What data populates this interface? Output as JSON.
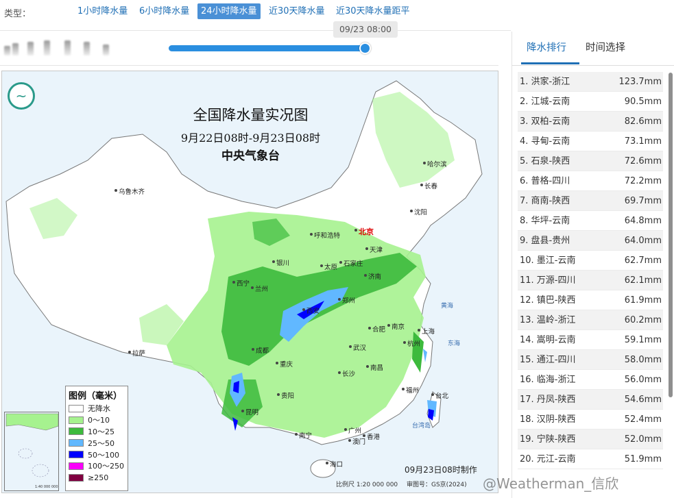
{
  "typebar": {
    "label": "类型：",
    "tabs": [
      {
        "label": "1小时降水量"
      },
      {
        "label": "6小时降水量"
      },
      {
        "label": "24小时降水量"
      },
      {
        "label": "近30天降水量"
      },
      {
        "label": "近30天降水量距平"
      }
    ],
    "active_tab": 2
  },
  "timeline": {
    "current_time": "09/23 08:00",
    "progress": 0.98
  },
  "map": {
    "title": "全国降水量实况图",
    "period": "9月22日08时-9月23日08时",
    "organization": "中央气象台",
    "made_time": "09月23日08时制作",
    "scale_note": "比例尺 1:20 000 000",
    "map_code": "审图号：GS京(2024)",
    "inset_caption": "1:40 000 000",
    "cities": [
      {
        "name": "乌鲁木齐"
      },
      {
        "name": "哈尔滨"
      },
      {
        "name": "长春"
      },
      {
        "name": "沈阳"
      },
      {
        "name": "北京"
      },
      {
        "name": "呼和浩特"
      },
      {
        "name": "天津"
      },
      {
        "name": "石家庄"
      },
      {
        "name": "太原"
      },
      {
        "name": "银川"
      },
      {
        "name": "济南"
      },
      {
        "name": "西宁"
      },
      {
        "name": "兰州"
      },
      {
        "name": "郑州"
      },
      {
        "name": "西安"
      },
      {
        "name": "合肥"
      },
      {
        "name": "南京"
      },
      {
        "name": "上海"
      },
      {
        "name": "杭州"
      },
      {
        "name": "武汉"
      },
      {
        "name": "成都"
      },
      {
        "name": "重庆"
      },
      {
        "name": "拉萨"
      },
      {
        "name": "长沙"
      },
      {
        "name": "南昌"
      },
      {
        "name": "福州"
      },
      {
        "name": "贵阳"
      },
      {
        "name": "昆明"
      },
      {
        "name": "南宁"
      },
      {
        "name": "广州"
      },
      {
        "name": "香港"
      },
      {
        "name": "澳门"
      },
      {
        "name": "海口"
      },
      {
        "name": "台北"
      }
    ],
    "seas": [
      {
        "name": "黄海"
      },
      {
        "name": "东海"
      },
      {
        "name": "台湾岛"
      }
    ],
    "legend": {
      "title": "图例（毫米）",
      "items": [
        {
          "label": "无降水",
          "color": "#ffffff"
        },
        {
          "label": "0～10",
          "color": "#a6f28f"
        },
        {
          "label": "10～25",
          "color": "#3dba3d"
        },
        {
          "label": "25～50",
          "color": "#61b8ff"
        },
        {
          "label": "50～100",
          "color": "#0000ff"
        },
        {
          "label": "100～250",
          "color": "#fa00fa"
        },
        {
          "label": "≥250",
          "color": "#800040"
        }
      ]
    }
  },
  "panel": {
    "tabs": [
      {
        "label": "降水排行"
      },
      {
        "label": "时间选择"
      }
    ],
    "rankings": [
      {
        "rank": "1.",
        "station": "洪家-浙江",
        "value": "123.7mm"
      },
      {
        "rank": "2.",
        "station": "江城-云南",
        "value": "90.5mm"
      },
      {
        "rank": "3.",
        "station": "双柏-云南",
        "value": "82.6mm"
      },
      {
        "rank": "4.",
        "station": "寻甸-云南",
        "value": "73.1mm"
      },
      {
        "rank": "5.",
        "station": "石泉-陕西",
        "value": "72.6mm"
      },
      {
        "rank": "6.",
        "station": "普格-四川",
        "value": "72.2mm"
      },
      {
        "rank": "7.",
        "station": "商南-陕西",
        "value": "69.7mm"
      },
      {
        "rank": "8.",
        "station": "华坪-云南",
        "value": "64.8mm"
      },
      {
        "rank": "9.",
        "station": "盘县-贵州",
        "value": "64.0mm"
      },
      {
        "rank": "10.",
        "station": "墨江-云南",
        "value": "62.7mm"
      },
      {
        "rank": "11.",
        "station": "万源-四川",
        "value": "62.1mm"
      },
      {
        "rank": "12.",
        "station": "镇巴-陕西",
        "value": "61.9mm"
      },
      {
        "rank": "13.",
        "station": "温岭-浙江",
        "value": "60.2mm"
      },
      {
        "rank": "14.",
        "station": "嵩明-云南",
        "value": "59.1mm"
      },
      {
        "rank": "15.",
        "station": "通江-四川",
        "value": "58.0mm"
      },
      {
        "rank": "16.",
        "station": "临海-浙江",
        "value": "56.0mm"
      },
      {
        "rank": "17.",
        "station": "丹凤-陕西",
        "value": "54.6mm"
      },
      {
        "rank": "18.",
        "station": "汉阴-陕西",
        "value": "52.4mm"
      },
      {
        "rank": "19.",
        "station": "宁陕-陕西",
        "value": "52.0mm"
      },
      {
        "rank": "20.",
        "station": "元江-云南",
        "value": "51.9mm"
      }
    ]
  },
  "watermark": "@Weatherman_信欣"
}
